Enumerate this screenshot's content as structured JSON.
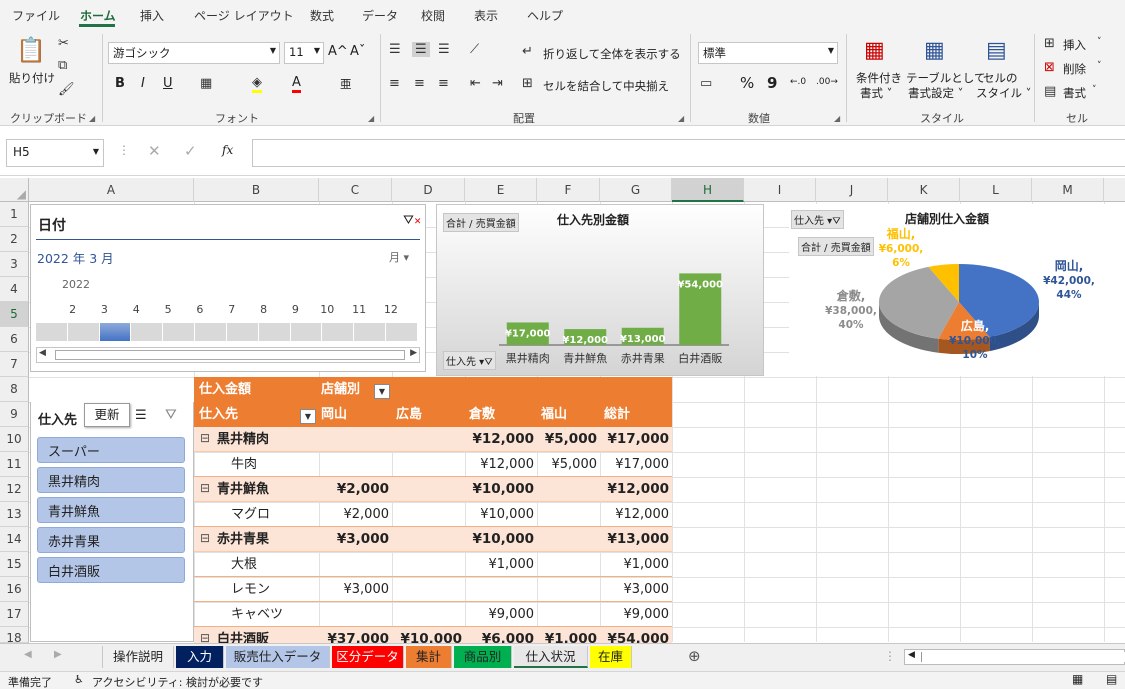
{
  "menu": {
    "items": [
      "ファイル",
      "ホーム",
      "挿入",
      "ページ レイアウト",
      "数式",
      "データ",
      "校閲",
      "表示",
      "ヘルプ"
    ]
  },
  "ribbon": {
    "clipboard": {
      "paste": "貼り付け",
      "label": "クリップボード"
    },
    "font": {
      "name": "游ゴシック",
      "size": "11",
      "label": "フォント",
      "grow": "A^",
      "shrink": "Aˇ",
      "bold": "B",
      "italic": "I",
      "underline": "U",
      "font_color": "A",
      "phonetic": "亜"
    },
    "alignment": {
      "wrap": "折り返して全体を表示する",
      "merge": "セルを結合して中央揃え",
      "label": "配置"
    },
    "number": {
      "format": "標準",
      "label": "数値",
      "percent": "%",
      "comma": "9",
      "dec_inc": "←.0",
      "dec_dec": ".00→"
    },
    "styles": {
      "conditional": [
        "条件付き",
        "書式 ˅"
      ],
      "table": [
        "テーブルとして",
        "書式設定 ˅"
      ],
      "cell": [
        "セルの",
        "スタイル ˅"
      ],
      "label": "スタイル"
    },
    "cells": {
      "insert": "挿入",
      "delete": "削除",
      "format": "書式",
      "label": "セル"
    }
  },
  "formula_bar": {
    "name_box": "H5",
    "fx": "fx",
    "value": ""
  },
  "columns": [
    "A",
    "B",
    "C",
    "D",
    "E",
    "F",
    "G",
    "H",
    "I",
    "J",
    "K",
    "L",
    "M"
  ],
  "rows": [
    "1",
    "2",
    "3",
    "4",
    "5",
    "6",
    "7",
    "8",
    "9",
    "10",
    "11",
    "12",
    "13",
    "14",
    "15",
    "16",
    "17",
    "18"
  ],
  "timeline": {
    "title": "日付",
    "period": "2022 年 3 月",
    "unit": "月",
    "year": "2022",
    "months": [
      "2",
      "3",
      "4",
      "5",
      "6",
      "7",
      "8",
      "9",
      "10",
      "11",
      "12"
    ],
    "selected_month": "3"
  },
  "bar_chart": {
    "field_button": "合計 / 売買金額",
    "axis_button": "仕入先"
  },
  "pie_chart": {
    "filter_button": "仕入先",
    "field_button": "合計 / 売買金額"
  },
  "chart_data": [
    {
      "type": "bar",
      "title": "仕入先別金額",
      "categories": [
        "黒井精肉",
        "青井鮮魚",
        "赤井青果",
        "白井酒販"
      ],
      "values": [
        17000,
        12000,
        13000,
        54000
      ],
      "data_labels": [
        "¥17,000",
        "¥12,000",
        "¥13,000",
        "¥54,000"
      ],
      "color": "#70ad47",
      "ylim": [
        0,
        60000
      ],
      "grid": false
    },
    {
      "type": "pie",
      "title": "店舗別仕入金額",
      "categories": [
        "岡山",
        "広島",
        "倉敷",
        "福山"
      ],
      "values": [
        42000,
        10000,
        38000,
        6000
      ],
      "labels": [
        [
          "岡山,",
          "¥42,000,",
          "44%"
        ],
        [
          "広島,",
          "¥10,000,",
          "10%"
        ],
        [
          "倉敷,",
          "¥38,000,",
          "40%"
        ],
        [
          "福山,",
          "¥6,000,",
          "6%"
        ]
      ],
      "colors": [
        "#4472c4",
        "#ed7d31",
        "#a5a5a5",
        "#ffc000"
      ]
    }
  ],
  "slicer": {
    "title": "仕入先",
    "refresh": "更新",
    "items": [
      "スーパー",
      "黒井精肉",
      "青井鮮魚",
      "赤井青果",
      "白井酒販"
    ]
  },
  "pivot": {
    "corner": "仕入金額",
    "col_field": "店舗別",
    "row_field": "仕入先",
    "headers": [
      "岡山",
      "広島",
      "倉敷",
      "福山",
      "総計"
    ],
    "rows": [
      {
        "label": "黒井精肉",
        "group": true,
        "values": [
          "",
          "",
          "¥12,000",
          "¥5,000",
          "¥17,000"
        ]
      },
      {
        "label": "牛肉",
        "group": false,
        "values": [
          "",
          "",
          "¥12,000",
          "¥5,000",
          "¥17,000"
        ]
      },
      {
        "label": "青井鮮魚",
        "group": true,
        "values": [
          "¥2,000",
          "",
          "¥10,000",
          "",
          "¥12,000"
        ]
      },
      {
        "label": "マグロ",
        "group": false,
        "values": [
          "¥2,000",
          "",
          "¥10,000",
          "",
          "¥12,000"
        ]
      },
      {
        "label": "赤井青果",
        "group": true,
        "values": [
          "¥3,000",
          "",
          "¥10,000",
          "",
          "¥13,000"
        ]
      },
      {
        "label": "大根",
        "group": false,
        "values": [
          "",
          "",
          "¥1,000",
          "",
          "¥1,000"
        ]
      },
      {
        "label": "レモン",
        "group": false,
        "values": [
          "¥3,000",
          "",
          "",
          "",
          "¥3,000"
        ]
      },
      {
        "label": "キャベツ",
        "group": false,
        "values": [
          "",
          "",
          "¥9,000",
          "",
          "¥9,000"
        ]
      },
      {
        "label": "白井酒販",
        "group": true,
        "values": [
          "¥37,000",
          "¥10,000",
          "¥6,000",
          "¥1,000",
          "¥54,000"
        ]
      }
    ]
  },
  "sheets": [
    {
      "name": "操作説明",
      "bg": "#f0f0f0",
      "fg": "#222"
    },
    {
      "name": "入力",
      "bg": "#002060",
      "fg": "#fff"
    },
    {
      "name": "販売仕入データ",
      "bg": "#b4c6e7",
      "fg": "#222"
    },
    {
      "name": "区分データ",
      "bg": "#ff0000",
      "fg": "#fff"
    },
    {
      "name": "集計",
      "bg": "#ed7d31",
      "fg": "#222"
    },
    {
      "name": "商品別",
      "bg": "#00b050",
      "fg": "#222"
    },
    {
      "name": "仕入状況",
      "bg": "#e8e8e8",
      "fg": "#222"
    },
    {
      "name": "在庫",
      "bg": "#ffff00",
      "fg": "#222"
    }
  ],
  "status": {
    "ready": "準備完了",
    "accessibility": "アクセシビリティ: 検討が必要です"
  }
}
